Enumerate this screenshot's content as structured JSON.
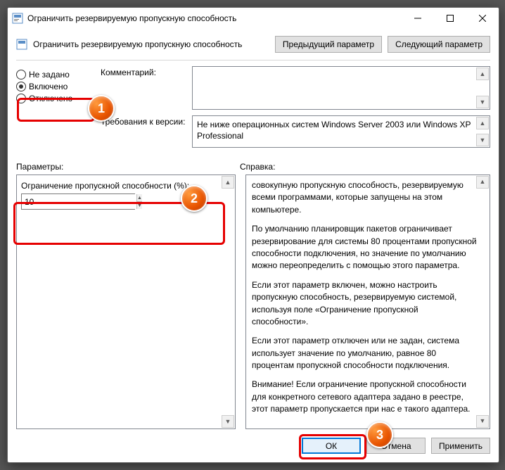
{
  "window": {
    "title": "Ограничить резервируемую пропускную способность"
  },
  "header": {
    "title": "Ограничить резервируемую пропускную способность",
    "prev_btn": "Предыдущий параметр",
    "next_btn": "Следующий параметр"
  },
  "radios": {
    "not_configured": "Не задано",
    "enabled": "Включено",
    "disabled": "Отключено"
  },
  "info": {
    "comment_label": "Комментарий:",
    "version_label": "Требования к версии:",
    "version_text": "Не ниже операционных систем Windows Server 2003 или Windows XP Professional"
  },
  "labels": {
    "params": "Параметры:",
    "help": "Справка:"
  },
  "params": {
    "bw_label": "Ограничение пропускной способности (%):",
    "bw_value": "10"
  },
  "help": {
    "p1": "совокупную пропускную способность, резервируемую всеми программами, которые запущены на этом компьютере.",
    "p2": "По умолчанию планировщик пакетов ограничивает резервирование для системы 80 процентами пропускной способности подключения, но значение по умолчанию можно переопределить с помощью этого параметра.",
    "p3": "Если этот параметр включен, можно настроить пропускную способность, резервируемую системой, используя поле «Ограничение пропускной способности».",
    "p4": "Если этот параметр отключен или не задан, система использует значение по умолчанию, равное 80 процентам пропускной способности подключения.",
    "p5": "Внимание! Если ограничение пропускной способности для конкретного сетевого адаптера задано в реестре, этот параметр пропускается при нас             е такого адаптера."
  },
  "buttons": {
    "ok": "ОК",
    "cancel": "Отмена",
    "apply": "Применить"
  },
  "callouts": {
    "c1": "1",
    "c2": "2",
    "c3": "3"
  }
}
